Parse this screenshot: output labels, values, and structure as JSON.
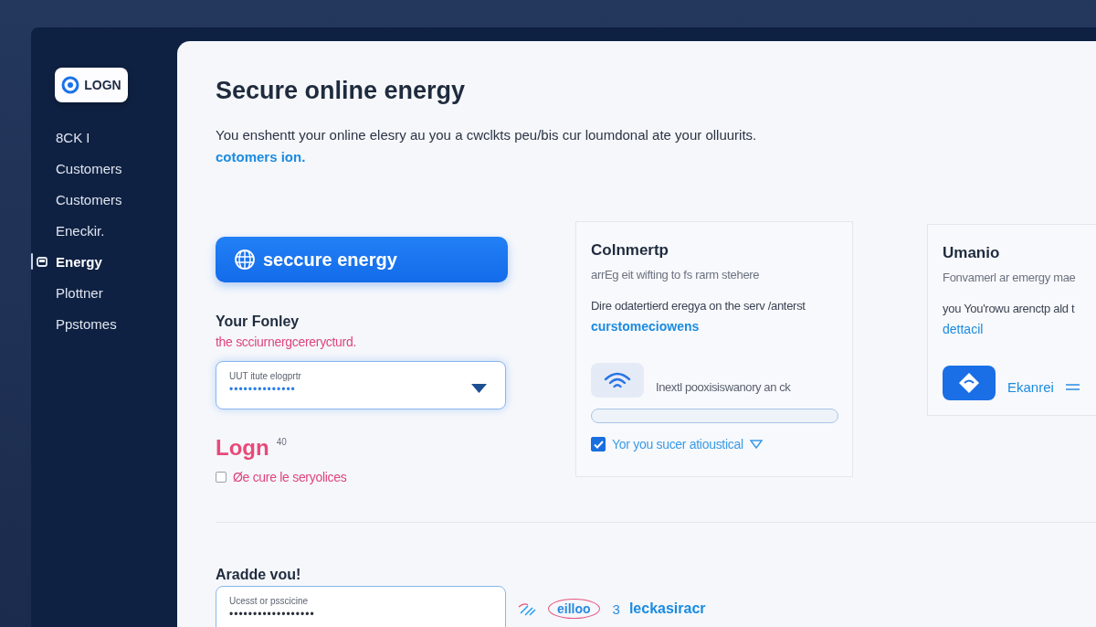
{
  "sidebar": {
    "logo": {
      "label": "LOGN"
    },
    "items": [
      {
        "label": "8CK I",
        "selected": false
      },
      {
        "label": "Customers",
        "selected": false
      },
      {
        "label": "Customers",
        "selected": false
      },
      {
        "label": "Eneckir.",
        "selected": false
      },
      {
        "label": "Energy",
        "selected": true
      },
      {
        "label": "Plottner",
        "selected": false
      },
      {
        "label": "Ppstomes",
        "selected": false
      }
    ]
  },
  "header": {
    "title": "Secure online energy",
    "description": "You enshentt your online elesry au you a cwclkts peu/bis cur loumdonal ate your olluurits.",
    "link": "cotomers ion."
  },
  "login_panel": {
    "button": "seccure energy",
    "heading": "Your Fonley",
    "note": "the scciurnergcererycturd.",
    "field": {
      "label": "UUT itute elogprtr",
      "value": "••••••••••••••"
    },
    "login": {
      "title": "Logn",
      "count": "40"
    },
    "consent": {
      "label": "Øe cure le seryolices",
      "checked": false
    }
  },
  "cards": [
    {
      "title": "Colnmertp",
      "lines": [
        "arrEg eit wifting to fs rarm stehere",
        "Dire odatertierd eregya on the serv /anterst"
      ],
      "link": "curstomeciowens",
      "tile": {
        "kind": "wifi",
        "label": "Inextl pooxisiswanory an ck"
      },
      "option": {
        "label": "Yor you sucer atioustical",
        "checked": true
      }
    },
    {
      "title": "Umanio",
      "lines": [
        "Fonvamerl ar emergy mae",
        "you You'rowu arenctp ald t"
      ],
      "link": "dettacil",
      "tile": {
        "kind": "diamond",
        "label": "Ekanrei"
      }
    }
  ],
  "signup": {
    "heading": "Aradde vou!",
    "field": {
      "label": "Ucesst or psscicine",
      "value": "••••••••••••••••••"
    },
    "brand": "eilloo",
    "count": "3",
    "link": "leckasiracr"
  }
}
